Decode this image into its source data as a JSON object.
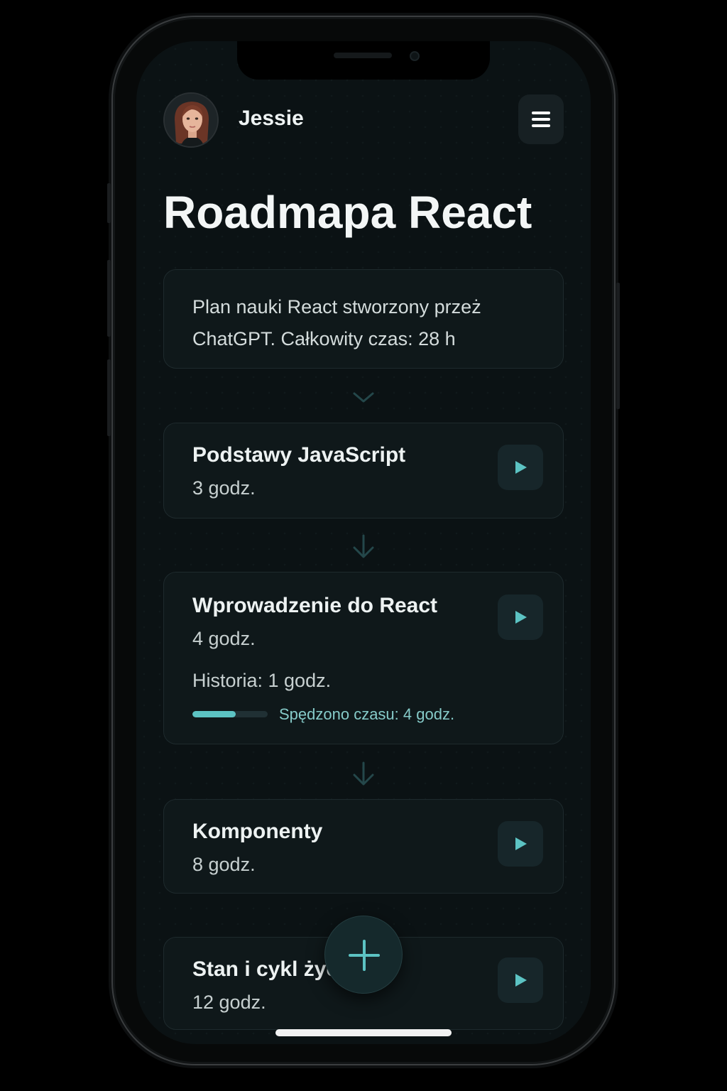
{
  "header": {
    "user_name": "Jessie"
  },
  "page": {
    "title": "Roadmapa React"
  },
  "intro": {
    "text": "Plan nauki React stworzony przeż ChatGPT. Całkowity czas: 28 h"
  },
  "steps": [
    {
      "title": "Podstawy JavaScript",
      "hours": "3 godz."
    },
    {
      "title": "Wprowadzenie do React",
      "hours": "4 godz.",
      "detail": "Historia: 1 godz.",
      "progress_fraction": 0.58,
      "spent": "Spędzono czasu: 4 godz."
    },
    {
      "title": "Komponenty",
      "hours": "8 godz."
    },
    {
      "title": "Stan i cykl życia",
      "hours": "12 godz."
    }
  ],
  "colors": {
    "accent": "#5cc3c3",
    "background": "#0b1214",
    "card": "#0f181a",
    "connector": "#24474a"
  },
  "icons": {
    "menu": "hamburger-icon",
    "play": "play-icon",
    "add": "plus-icon",
    "connector_first": "chevron-down-icon",
    "connector": "arrow-down-icon"
  }
}
